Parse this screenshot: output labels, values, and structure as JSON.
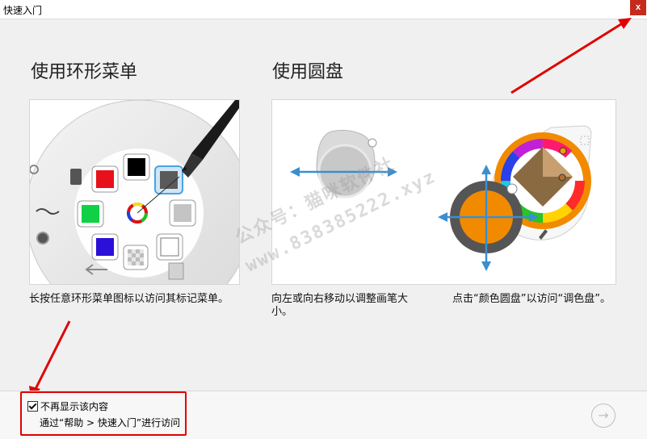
{
  "window": {
    "title": "快速入门",
    "close_label": "x"
  },
  "sections": [
    {
      "title": "使用环形菜单",
      "caption": "长按任意环形菜单图标以访问其标记菜单。"
    },
    {
      "title": "使用圆盘",
      "caption_left": "向左或向右移动以调整画笔大小。",
      "caption_right": "点击“颜色圆盘”以访问“调色盘”。"
    }
  ],
  "watermark": {
    "line1": "公众号：猫咪软件社",
    "line2": "www.838385222.xyz"
  },
  "footer": {
    "dont_show_label": "不再显示该内容",
    "dont_show_checked": true,
    "hint": "通过“帮助 > 快速入门”进行访问"
  },
  "icons": {
    "close": "close-icon",
    "next": "arrow-right-circle-icon",
    "checkbox": "checkbox-checked-icon"
  },
  "colors": {
    "accent_red": "#e00000",
    "orange": "#f28a00",
    "arrow_blue": "#3a8fd0"
  }
}
